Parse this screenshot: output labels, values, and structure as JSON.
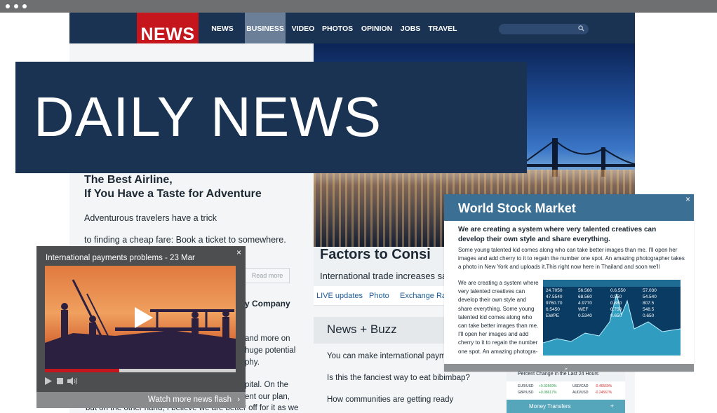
{
  "colors": {
    "navy": "#1b3353",
    "brand_red": "#c4161c",
    "link_blue": "#1a5a96",
    "panel_blue": "#3b6f93",
    "accent_teal": "#56a6bb"
  },
  "site": {
    "logo": "NEWS"
  },
  "nav": [
    "NEWS",
    "BUSINESS",
    "VIDEO",
    "PHOTOS",
    "OPINION",
    "JOBS",
    "TRAVEL"
  ],
  "nav_active": "BUSINESS",
  "banner": {
    "title": "DAILY NEWS"
  },
  "article": {
    "title_line1": "The Best Airline,",
    "title_line2": "If You Have a Taste for Adventure",
    "para1": "Adventurous travelers have a trick",
    "para2": "to finding a cheap fare: Book a ticket to somewhere.",
    "read_more": "Read more",
    "section_partial": "y Company",
    "frag1": "and more on",
    "frag2": "huge potential",
    "frag3": "phy.",
    "frag4": "pital. On the",
    "frag5": "ent our plan,",
    "bottom_line": "but on the other hand, I believe we are better off for it as we"
  },
  "feature": {
    "title": "Factors to Consi",
    "subtitle": "International trade increases sa",
    "tabs": [
      "LIVE updates",
      "Photo",
      "Exchange Rat"
    ]
  },
  "buzz": {
    "title": "News + Buzz",
    "items": [
      "You can make international payme",
      "Is this the fanciest way to eat bibimbap?",
      "How communities are getting ready"
    ]
  },
  "video": {
    "title": "International payments problems - 23 Mar",
    "close": "×",
    "progress": 0.39,
    "more": "Watch more news flash",
    "icons": {
      "play": "play-icon",
      "stop": "stop-icon",
      "volume": "volume-icon"
    }
  },
  "stock_panel": {
    "title": "World Stock Market",
    "close": "×",
    "lead": "We are creating a system where very talented creatives can develop their own style and share everything.",
    "body": "Some young talented kid comes along who can take better images than me. I'll open her images and add cherry to it to regain the number one spot. An amazing photographer takes a photo in New York and uploads it.This right now here in Thailand and soon we'll",
    "column": "We are creating a system where very talented creatives can develop their own style and share everything. Some young talented kid comes along who can take better images than me. I'll open her images and add cherry to it to regain the number one spot. An amazing photogra-",
    "chart_labels": [
      "24.7050",
      "47.5540",
      "9760.70",
      "6.5450",
      "EWPE",
      "56.560",
      "68.560",
      "4.9770",
      "WEF",
      "0.5340",
      "0.6.550",
      "0.550",
      "0.880",
      "0.750",
      "0.650",
      "57.030",
      "54.540",
      "807.5",
      "548.5",
      "0.650"
    ],
    "footer_icon": "chevron-down-icon"
  },
  "widget": {
    "title": "Percent Change in the Last 24 Hours",
    "rows": [
      {
        "pair1": "EUR/USD",
        "val1": "+0.32569%",
        "pair2": "USD/CAD",
        "val2": "-0.46569%"
      },
      {
        "pair1": "GBP/USD",
        "val1": "+0.08617%",
        "pair2": "AUD/USD",
        "val2": "-0.24567%"
      }
    ],
    "money": "Money Transfers",
    "money_icon": "+"
  }
}
